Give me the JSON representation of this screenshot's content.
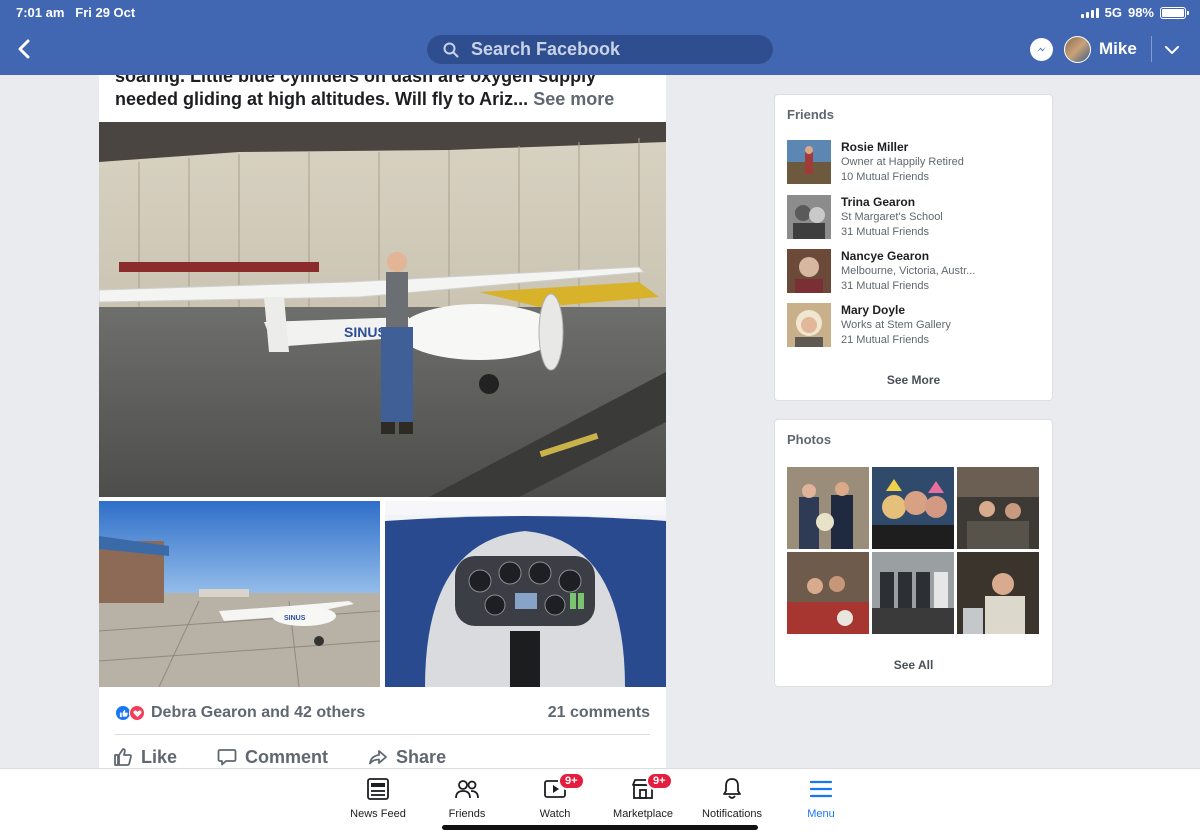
{
  "status_bar": {
    "time": "7:01 am",
    "date": "Fri 29 Oct",
    "network": "5G",
    "battery": "98%",
    "battery_level": 0.98
  },
  "header": {
    "search_placeholder": "Search Facebook",
    "user_name": "Mike"
  },
  "post": {
    "text_line1": "soaring. Little blue cylinders on dash are oxygen supply",
    "text_line2": "needed gliding at high altitudes. Will fly to Ariz...",
    "see_more": "See more",
    "reactions_text": "Debra Gearon and 42 others",
    "comments_text": "21 comments",
    "actions": {
      "like": "Like",
      "comment": "Comment",
      "share": "Share"
    },
    "photo_main_label": "SINUS",
    "photo_left_label": "SINUS"
  },
  "friends": {
    "title": "Friends",
    "items": [
      {
        "name": "Rosie Miller",
        "subtitle": "Owner at Happily Retired",
        "mutual": "10 Mutual Friends"
      },
      {
        "name": "Trina Gearon",
        "subtitle": "St Margaret's School",
        "mutual": "31 Mutual Friends"
      },
      {
        "name": "Nancye Gearon",
        "subtitle": "Melbourne, Victoria, Austr...",
        "mutual": "31 Mutual Friends"
      },
      {
        "name": "Mary Doyle",
        "subtitle": "Works at Stem Gallery",
        "mutual": "21 Mutual Friends"
      }
    ],
    "see_more": "See More"
  },
  "photos": {
    "title": "Photos",
    "see_all": "See All"
  },
  "tabbar": {
    "items": [
      {
        "label": "News Feed",
        "icon": "news-feed-icon",
        "badge": ""
      },
      {
        "label": "Friends",
        "icon": "friends-icon",
        "badge": ""
      },
      {
        "label": "Watch",
        "icon": "watch-icon",
        "badge": "9+"
      },
      {
        "label": "Marketplace",
        "icon": "marketplace-icon",
        "badge": "9+"
      },
      {
        "label": "Notifications",
        "icon": "bell-icon",
        "badge": ""
      },
      {
        "label": "Menu",
        "icon": "menu-icon",
        "badge": ""
      }
    ]
  },
  "colors": {
    "brand": "#4267b2",
    "search_bg": "#2f4e8f",
    "accent": "#1877f2",
    "badge": "#e41e3f",
    "background": "#e9ebee"
  }
}
